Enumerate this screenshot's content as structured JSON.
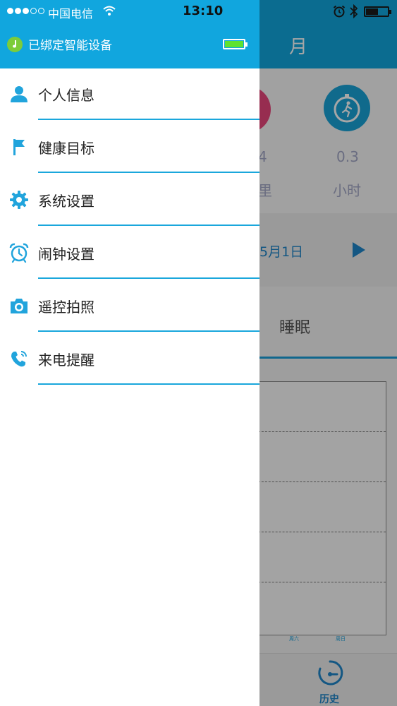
{
  "status_bar": {
    "carrier": "中国电信",
    "time": "13:10"
  },
  "background_app": {
    "title": "月",
    "stats": [
      {
        "value": "4",
        "unit": "里",
        "color": "#e9457c"
      },
      {
        "value": "0.3",
        "unit": "小时",
        "color": "#19a4d8",
        "icon": "running-timer-icon"
      }
    ],
    "date": "5月1日",
    "active_tab": "睡眠",
    "chart": {
      "x_labels": [
        "周六",
        "周日"
      ]
    },
    "footer": {
      "history_label": "历史"
    }
  },
  "drawer": {
    "device_status": "已绑定智能设备",
    "menu": [
      {
        "label": "个人信息",
        "icon": "person-icon"
      },
      {
        "label": "健康目标",
        "icon": "flag-icon"
      },
      {
        "label": "系统设置",
        "icon": "gear-icon"
      },
      {
        "label": "闹钟设置",
        "icon": "alarm-clock-icon"
      },
      {
        "label": "遥控拍照",
        "icon": "camera-icon"
      },
      {
        "label": "来电提醒",
        "icon": "phone-icon"
      }
    ]
  },
  "colors": {
    "accent": "#11a6de",
    "separator": "#1aa7dc",
    "battery_green": "#5ee22f"
  }
}
